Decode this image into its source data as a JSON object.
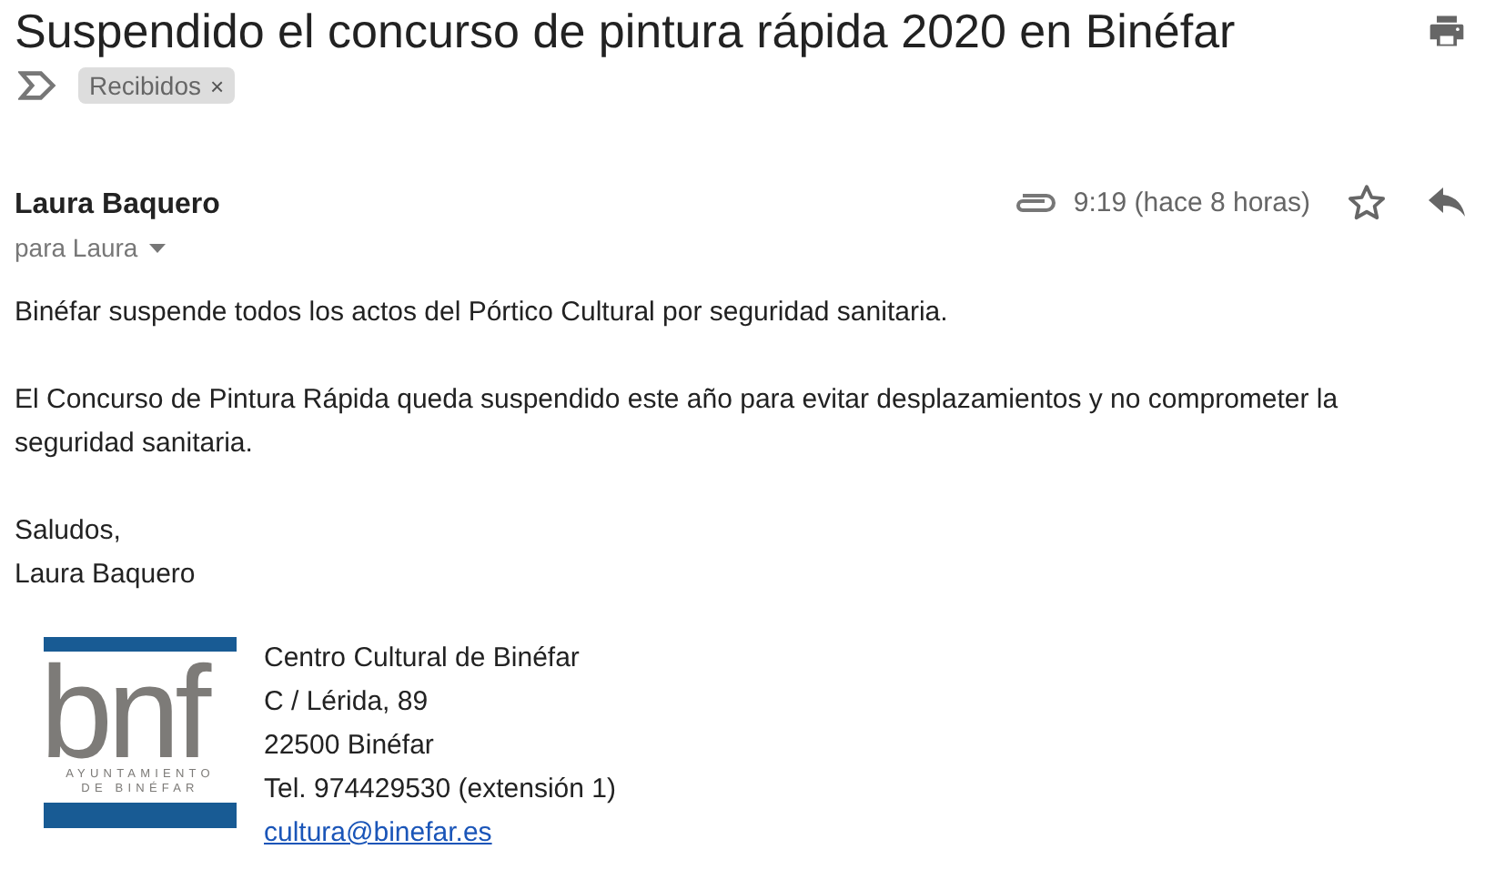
{
  "subject": "Suspendido el concurso de pintura rápida 2020 en Binéfar",
  "labels": [
    {
      "text": "Recibidos",
      "remove": "×"
    }
  ],
  "message": {
    "sender": "Laura Baquero",
    "recipient": "para Laura",
    "has_attachment": true,
    "time": "9:19 (hace 8 horas)",
    "starred": false
  },
  "body": [
    [
      "Binéfar suspende todos los actos del Pórtico Cultural por seguridad sanitaria."
    ],
    [
      "El Concurso de Pintura Rápida queda suspendido este año para evitar desplazamientos y no comprometer la seguridad sanitaria."
    ],
    [
      "Saludos,",
      "Laura Baquero"
    ]
  ],
  "signature": {
    "logo": {
      "mark": "bnf",
      "lines": [
        "AYUNTAMIENTO",
        "DE BINÉFAR"
      ]
    },
    "lines": [
      "Centro Cultural de Binéfar",
      "C / Lérida, 89",
      "22500 Binéfar",
      "Tel. 974429530 (extensión 1)"
    ],
    "email": "cultura@binefar.es"
  }
}
